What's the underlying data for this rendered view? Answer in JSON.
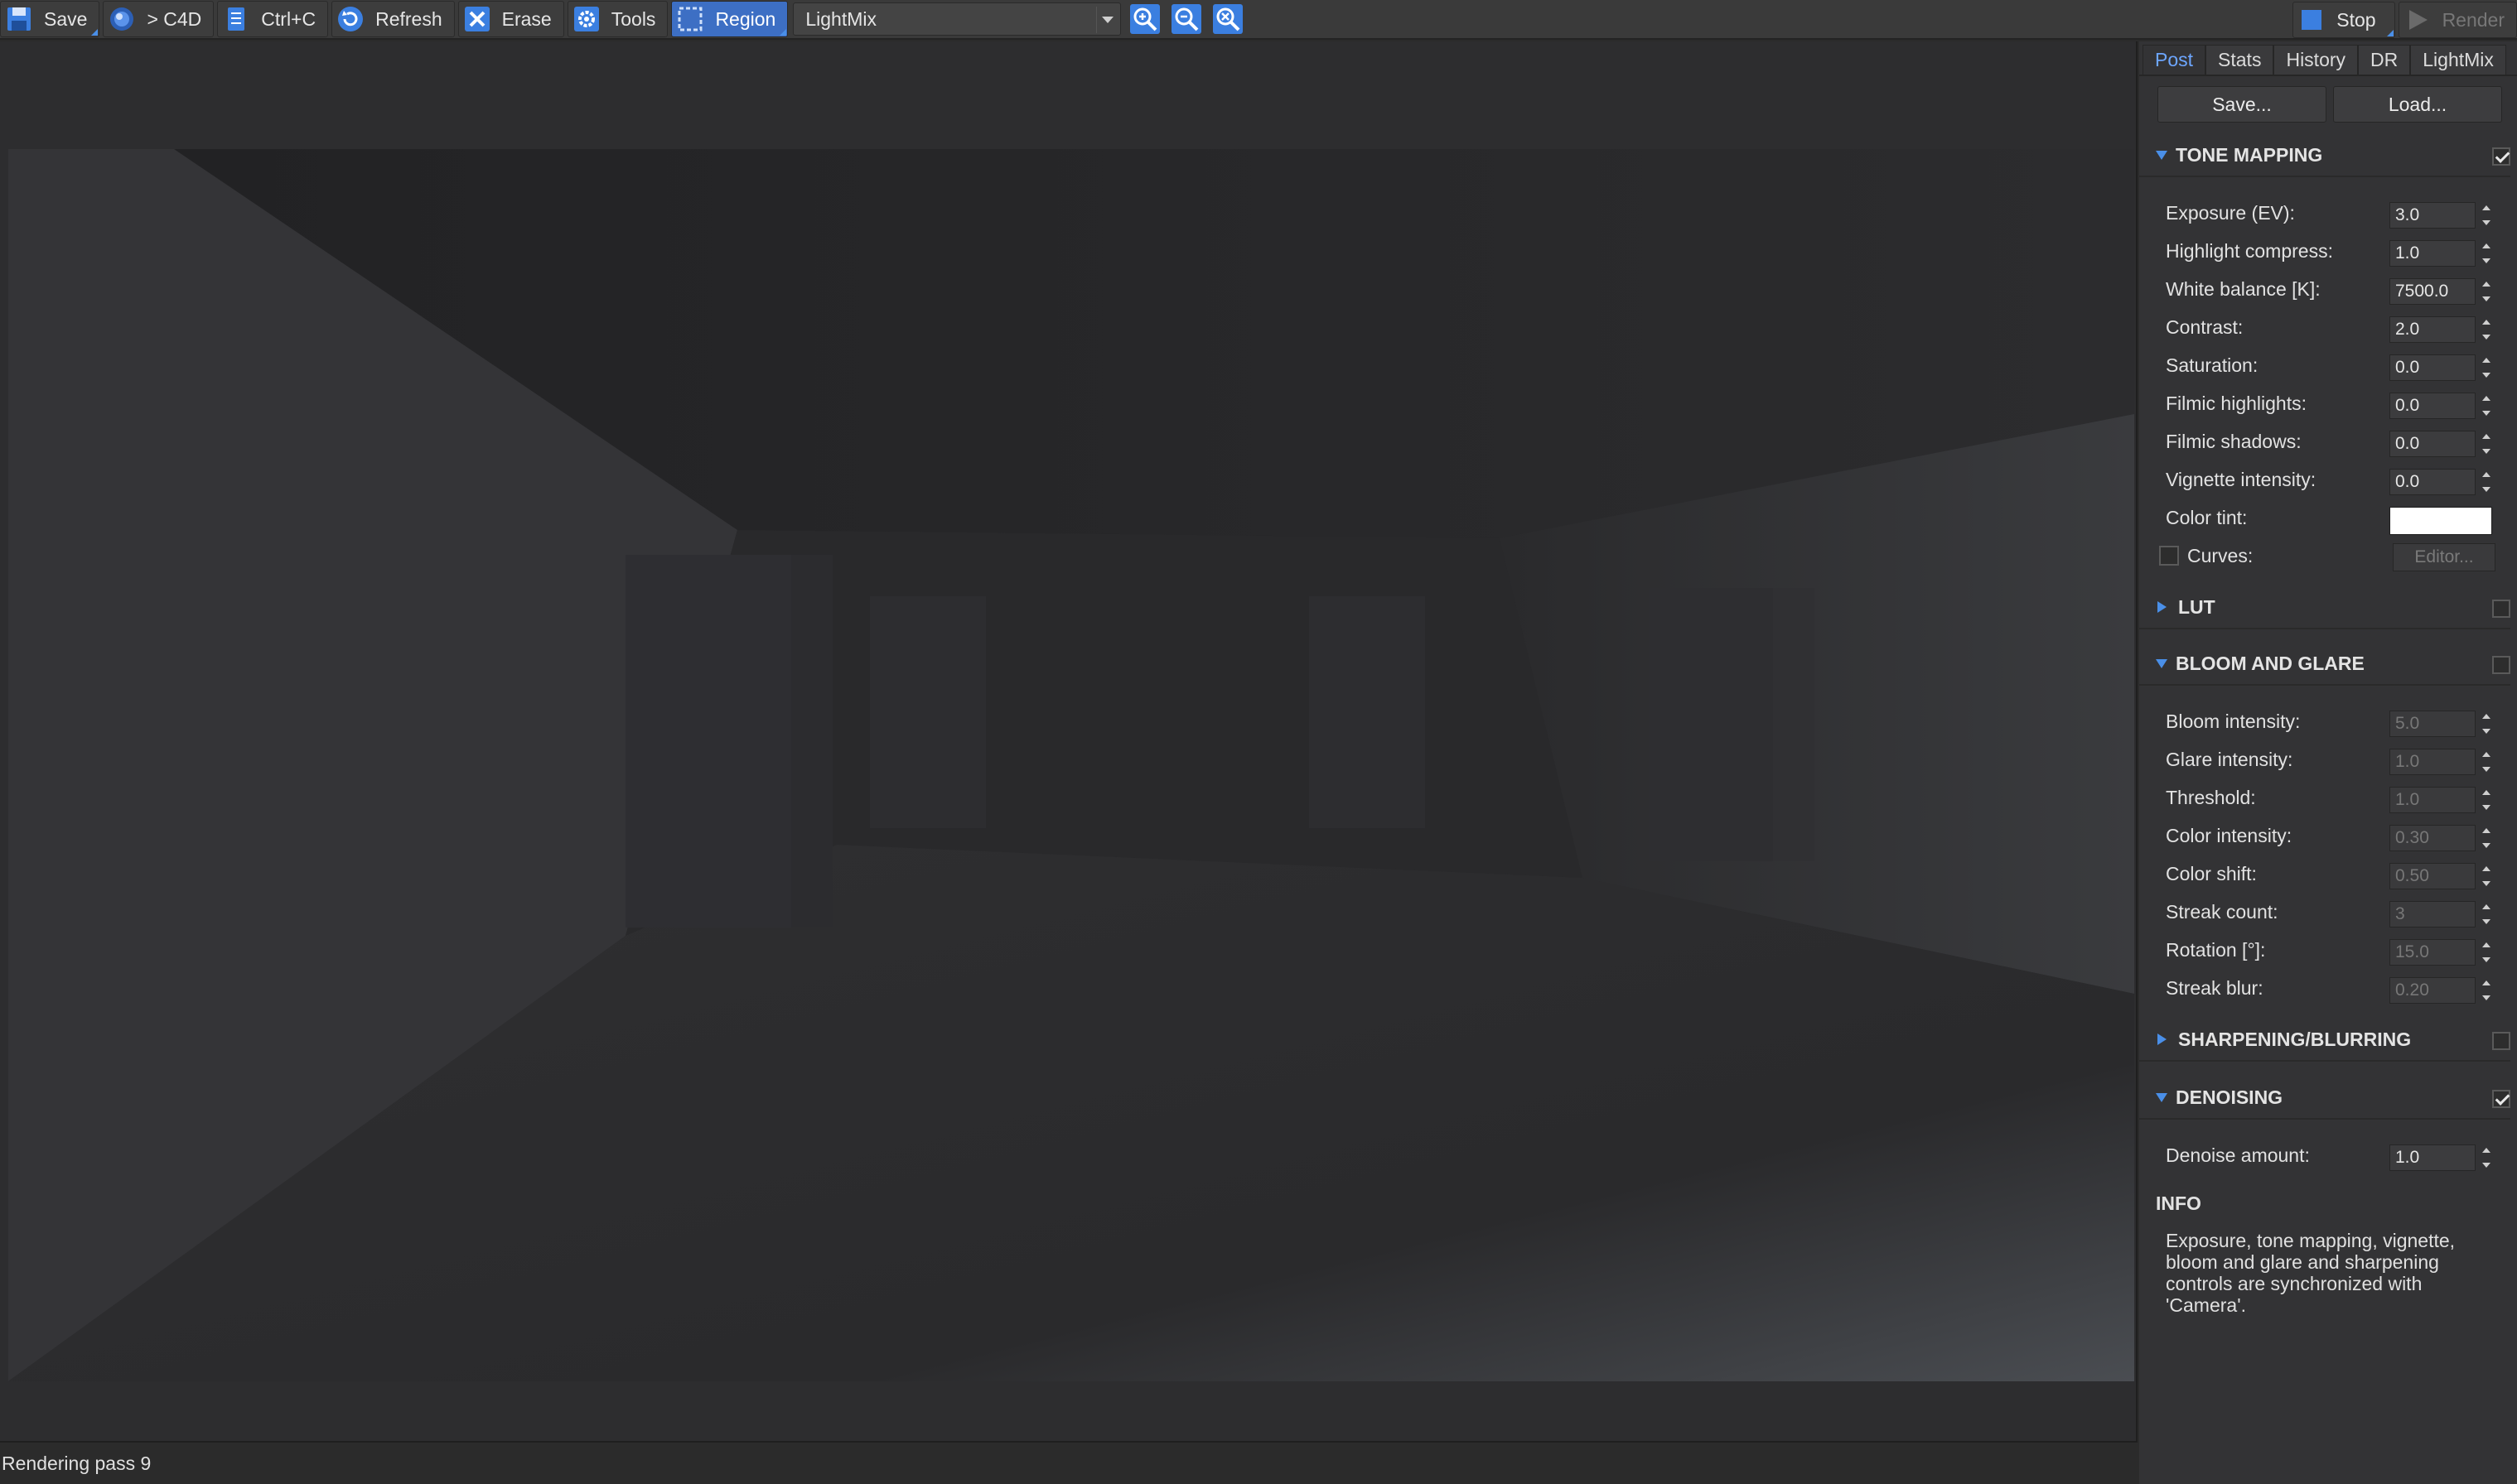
{
  "toolbar": {
    "save": "Save",
    "to_c4d": "> C4D",
    "copy": "Ctrl+C",
    "refresh": "Refresh",
    "erase": "Erase",
    "tools": "Tools",
    "region": "Region",
    "display_select": "LightMix",
    "stop": "Stop",
    "render": "Render",
    "icons": [
      "save-icon",
      "c4d-icon",
      "copy-icon",
      "refresh-icon",
      "erase-icon",
      "gear-icon",
      "region-icon",
      "zoom-in-icon",
      "zoom-out-icon",
      "zoom-fit-icon",
      "stop-icon",
      "play-icon"
    ],
    "accent": "#4a8fe8"
  },
  "status": {
    "text": "Rendering pass 9"
  },
  "panel": {
    "tabs": [
      "Post",
      "Stats",
      "History",
      "DR",
      "LightMix"
    ],
    "active_tab": "Post",
    "save_btn": "Save...",
    "load_btn": "Load...",
    "tone_mapping": {
      "title": "TONE MAPPING",
      "enabled": true,
      "rows": [
        {
          "label": "Exposure (EV):",
          "value": "3.0"
        },
        {
          "label": "Highlight compress:",
          "value": "1.0"
        },
        {
          "label": "White balance [K]:",
          "value": "7500.0"
        },
        {
          "label": "Contrast:",
          "value": "2.0"
        },
        {
          "label": "Saturation:",
          "value": "0.0"
        },
        {
          "label": "Filmic highlights:",
          "value": "0.0"
        },
        {
          "label": "Filmic shadows:",
          "value": "0.0"
        },
        {
          "label": "Vignette intensity:",
          "value": "0.0"
        }
      ],
      "color_tint_label": "Color tint:",
      "color_tint": "#ffffff",
      "curves_label": "Curves:",
      "curves_enabled": false,
      "editor_btn": "Editor..."
    },
    "lut": {
      "title": "LUT",
      "enabled": false
    },
    "bloom": {
      "title": "BLOOM AND GLARE",
      "enabled": false,
      "rows": [
        {
          "label": "Bloom intensity:",
          "value": "5.0"
        },
        {
          "label": "Glare intensity:",
          "value": "1.0"
        },
        {
          "label": "Threshold:",
          "value": "1.0"
        },
        {
          "label": "Color intensity:",
          "value": "0.30"
        },
        {
          "label": "Color shift:",
          "value": "0.50"
        },
        {
          "label": "Streak count:",
          "value": "3"
        },
        {
          "label": "Rotation [°]:",
          "value": "15.0"
        },
        {
          "label": "Streak blur:",
          "value": "0.20"
        }
      ]
    },
    "sharpen": {
      "title": "SHARPENING/BLURRING",
      "enabled": false
    },
    "denoise": {
      "title": "DENOISING",
      "enabled": true,
      "rows": [
        {
          "label": "Denoise amount:",
          "value": "1.0"
        }
      ]
    },
    "info": {
      "title": "INFO",
      "text": "Exposure, tone mapping, vignette, bloom and glare and sharpening controls are synchronized with 'Camera'."
    }
  }
}
